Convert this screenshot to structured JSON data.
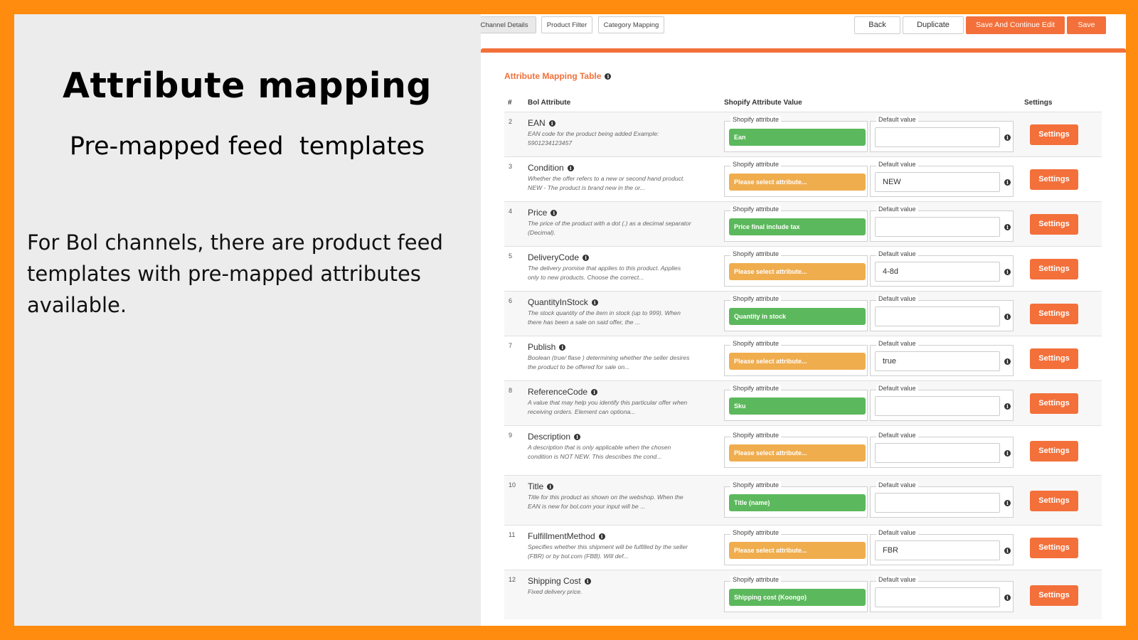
{
  "slide": {
    "title": "Attribute mapping",
    "subtitle": "Pre-mapped feed  templates",
    "body": "For Bol channels, there are product feed templates with pre-mapped attributes available."
  },
  "toolbar": {
    "tabs": [
      "Channel Details",
      "Product Filter",
      "Category Mapping"
    ],
    "back_label": "Back",
    "duplicate_label": "Duplicate",
    "save_continue_label": "Save And Continue Edit",
    "save_label": "Save"
  },
  "table": {
    "title": "Attribute Mapping Table",
    "headers": {
      "num": "#",
      "bol": "Bol Attribute",
      "shopify": "Shopify Attribute Value",
      "settings": "Settings"
    },
    "shopify_legend": "Shopify attribute",
    "default_legend": "Default value",
    "settings_label": "Settings",
    "rows": [
      {
        "num": "2",
        "name": "EAN",
        "desc": "EAN code for the product being added Example: 5901234123457",
        "shopify": "Ean",
        "status": "mapped",
        "default": ""
      },
      {
        "num": "3",
        "name": "Condition",
        "desc": "Whether the offer refers to a new or second hand product. NEW - The product is brand new in the or...",
        "shopify": "Please select attribute...",
        "status": "unmapped",
        "default": "NEW"
      },
      {
        "num": "4",
        "name": "Price",
        "desc": "The price of the product with a dot (.) as a decimal separator (Decimal).",
        "shopify": "Price final include tax",
        "status": "mapped",
        "default": ""
      },
      {
        "num": "5",
        "name": "DeliveryCode",
        "desc": "The delivery promise that applies to this product. Applies only to new products. Choose the correct...",
        "shopify": "Please select attribute...",
        "status": "unmapped",
        "default": "4-8d"
      },
      {
        "num": "6",
        "name": "QuantityInStock",
        "desc": "The stock quantity of the item in stock (up to 999). When there has been a sale on said offer, the ...",
        "shopify": "Quantity in stock",
        "status": "mapped",
        "default": ""
      },
      {
        "num": "7",
        "name": "Publish",
        "desc": "Boolean (true/ flase ) determining whether the seller desires the product to be offered for sale on...",
        "shopify": "Please select attribute...",
        "status": "unmapped",
        "default": "true"
      },
      {
        "num": "8",
        "name": "ReferenceCode",
        "desc": "A value that may help you identify this particular offer when receiving orders. Element can optiona...",
        "shopify": "Sku",
        "status": "mapped",
        "default": ""
      },
      {
        "num": "9",
        "name": "Description",
        "desc": "A description that is only applicable when the chosen condition is NOT NEW. This describes the cond...",
        "shopify": "Please select attribute...",
        "status": "unmapped",
        "default": ""
      },
      {
        "num": "10",
        "name": "Title",
        "desc": "Title for this product as shown on the webshop. When the EAN is new for bol.com your input will be ...",
        "shopify": "Title (name)",
        "status": "mapped",
        "default": ""
      },
      {
        "num": "11",
        "name": "FulfillmentMethod",
        "desc": "Specifies whether this shipment will be fulfilled by the seller (FBR) or by bol.com (FBB). Will def...",
        "shopify": "Please select attribute...",
        "status": "unmapped",
        "default": "FBR"
      },
      {
        "num": "12",
        "name": "Shipping Cost",
        "desc": "Fixed delivery price.",
        "shopify": "Shipping cost (Koongo)",
        "status": "mapped",
        "default": ""
      }
    ]
  },
  "colors": {
    "frame": "#FF8C0F",
    "accent": "#F3703A",
    "mapped": "#5CB85C",
    "unmapped": "#F0AD4E"
  }
}
